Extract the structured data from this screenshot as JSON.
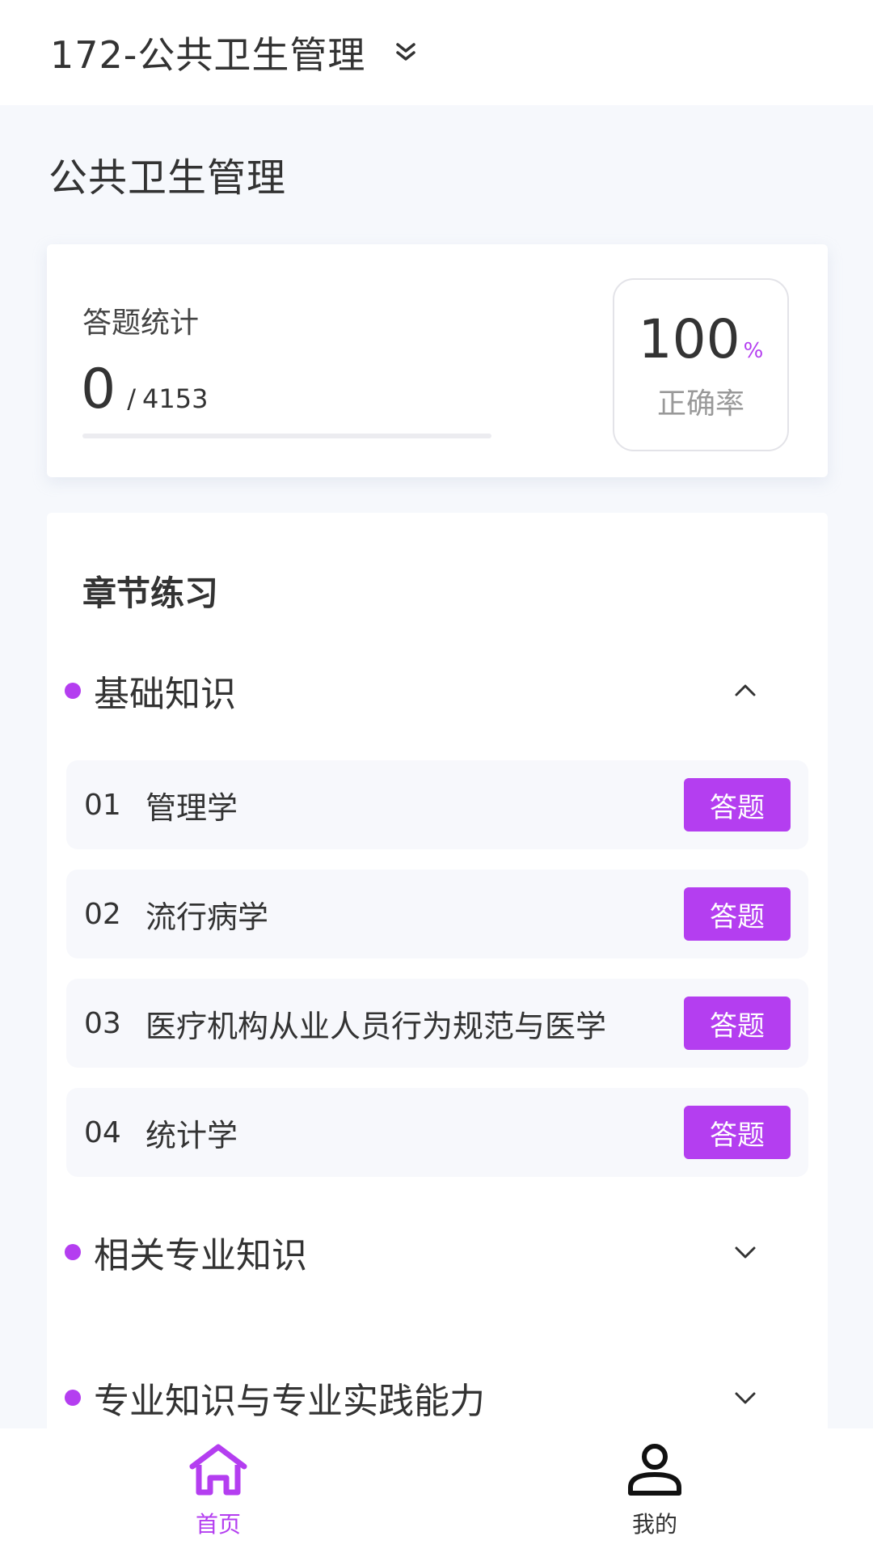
{
  "header": {
    "exam_title": "172-公共卫生管理",
    "switch_icon": "double-chevron-down-icon"
  },
  "page": {
    "subject_title": "公共卫生管理"
  },
  "stats": {
    "label": "答题统计",
    "answered": "0",
    "separator": "/",
    "total": "4153",
    "progress_fraction": 0,
    "accuracy_value": "100",
    "accuracy_unit": "%",
    "accuracy_label": "正确率"
  },
  "chapters": {
    "title": "章节练习",
    "sections": [
      {
        "label": "基础知识",
        "state": "expanded",
        "toggle_icon": "chevron-up-icon",
        "items": [
          {
            "index": "01",
            "name": "管理学",
            "button": "答题"
          },
          {
            "index": "02",
            "name": "流行病学",
            "button": "答题"
          },
          {
            "index": "03",
            "name": "医疗机构从业人员行为规范与医学",
            "button": "答题"
          },
          {
            "index": "04",
            "name": "统计学",
            "button": "答题"
          }
        ]
      },
      {
        "label": "相关专业知识",
        "state": "collapsed",
        "toggle_icon": "chevron-down-icon"
      },
      {
        "label": "专业知识与专业实践能力",
        "state": "collapsed",
        "toggle_icon": "chevron-down-icon"
      }
    ]
  },
  "bottom_nav": {
    "items": [
      {
        "label": "首页",
        "icon": "home-icon",
        "active": true
      },
      {
        "label": "我的",
        "icon": "user-icon",
        "active": false
      }
    ]
  },
  "colors": {
    "accent": "#b43ef0",
    "background": "#f6f8fc",
    "text": "#333333"
  }
}
